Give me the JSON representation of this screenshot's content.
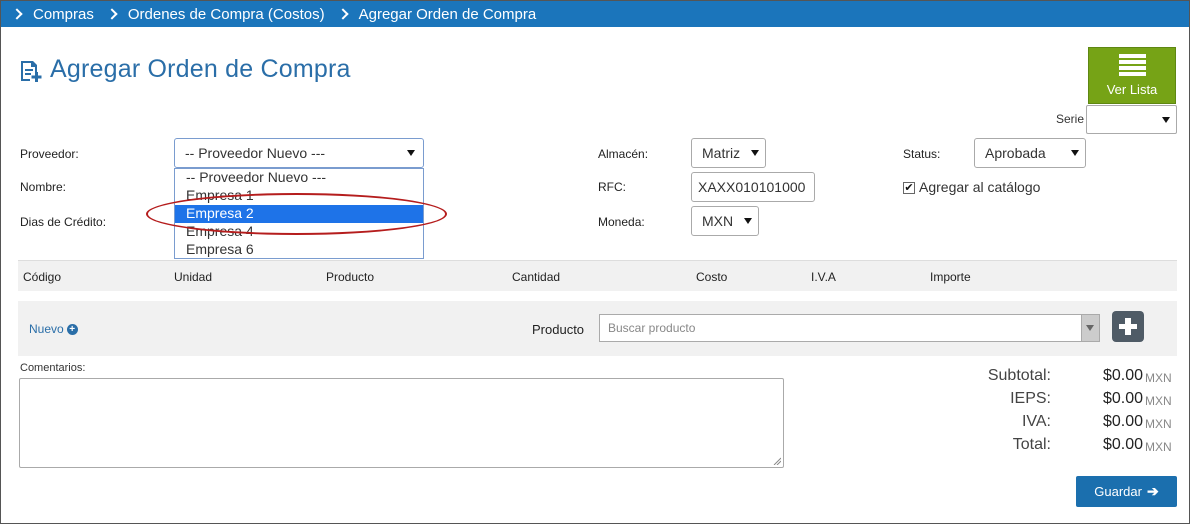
{
  "breadcrumb": {
    "items": [
      "Compras",
      "Ordenes de Compra (Costos)",
      "Agregar Orden de Compra"
    ]
  },
  "page_title": "Agregar Orden de Compra",
  "ver_lista_label": "Ver Lista",
  "serie": {
    "label": "Serie",
    "value": ""
  },
  "form": {
    "proveedor_label": "Proveedor:",
    "proveedor_value": "-- Proveedor Nuevo ---",
    "nombre_label": "Nombre:",
    "dias_credito_label": "Dias de Crédito:",
    "almacen_label": "Almacén:",
    "almacen_value": "Matriz",
    "rfc_label": "RFC:",
    "rfc_value": "XAXX010101000",
    "moneda_label": "Moneda:",
    "moneda_value": "MXN",
    "status_label": "Status:",
    "status_value": "Aprobada",
    "catalogo_label": "Agregar al catálogo",
    "catalogo_checked": true
  },
  "proveedor_options": [
    "-- Proveedor Nuevo ---",
    "Empresa 1",
    "Empresa 2",
    "Empresa 4",
    "Empresa 6"
  ],
  "proveedor_highlighted": "Empresa 2",
  "table": {
    "headers": [
      "Código",
      "Unidad",
      "Producto",
      "Cantidad",
      "Costo",
      "I.V.A",
      "Importe"
    ]
  },
  "add_row": {
    "nuevo_label": "Nuevo",
    "producto_label": "Producto",
    "search_placeholder": "Buscar producto"
  },
  "comentarios_label": "Comentarios:",
  "totals": [
    {
      "label": "Subtotal:",
      "value": "$0.00",
      "currency": "MXN"
    },
    {
      "label": "IEPS:",
      "value": "$0.00",
      "currency": "MXN"
    },
    {
      "label": "IVA:",
      "value": "$0.00",
      "currency": "MXN"
    },
    {
      "label": "Total:",
      "value": "$0.00",
      "currency": "MXN"
    }
  ],
  "guardar_label": "Guardar",
  "colors": {
    "header_bar": "#1b75bb",
    "ver_lista_bg": "#76a316",
    "guardar_bg": "#1b6fae",
    "highlight": "#1e73e8",
    "annotation_ellipse": "#b51d1d"
  }
}
